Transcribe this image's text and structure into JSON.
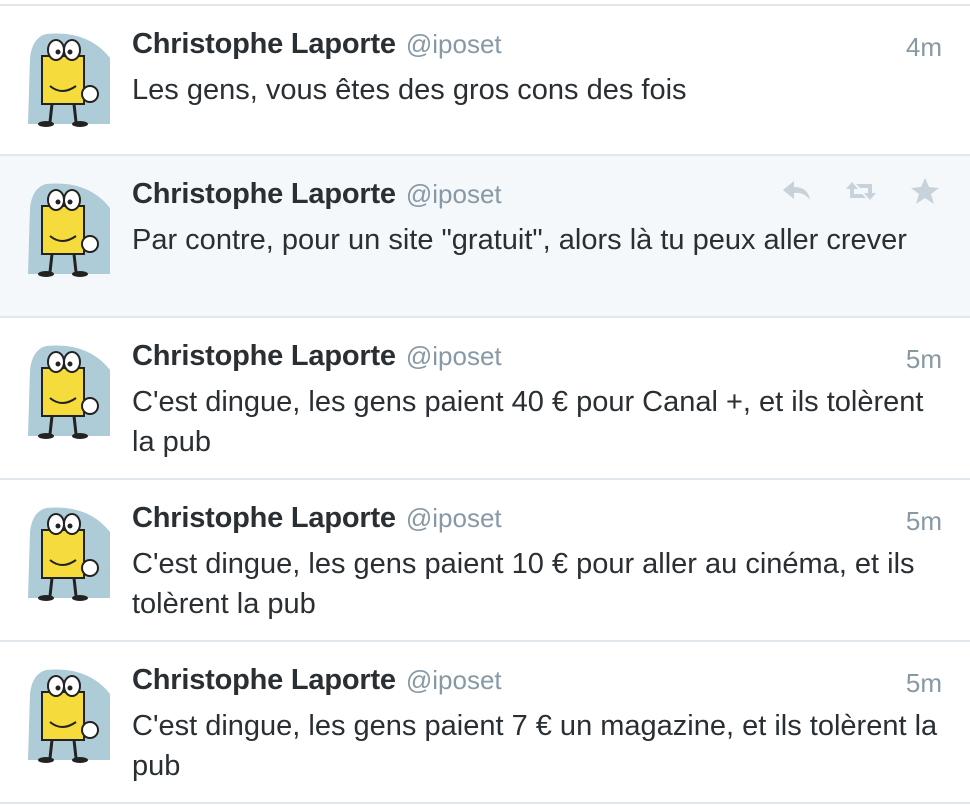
{
  "tweets": [
    {
      "name": "Christophe Laporte",
      "handle": "@iposet",
      "time": "4m",
      "text": "Les gens, vous êtes des gros cons des fois"
    },
    {
      "name": "Christophe Laporte",
      "handle": "@iposet",
      "time": "",
      "text": "Par contre, pour un site \"gratuit\",  alors là tu peux aller crever",
      "actions": [
        "reply-icon",
        "retweet-icon",
        "favorite-icon"
      ]
    },
    {
      "name": "Christophe Laporte",
      "handle": "@iposet",
      "time": "5m",
      "text": "C'est dingue, les gens paient 40 € pour Canal +, et ils tolèrent la pub"
    },
    {
      "name": "Christophe Laporte",
      "handle": "@iposet",
      "time": "5m",
      "text": "C'est dingue, les gens paient 10 € pour aller au cinéma, et ils tolèrent la pub"
    },
    {
      "name": "Christophe Laporte",
      "handle": "@iposet",
      "time": "5m",
      "text": "C'est dingue, les gens paient 7 € un magazine, et ils tolèrent la pub"
    }
  ],
  "colors": {
    "name": "#292f33",
    "muted": "#8899a6",
    "divider": "#e1e8ed",
    "avatar_bg": "#aecbd8",
    "avatar_yellow": "#f5dc3c"
  }
}
